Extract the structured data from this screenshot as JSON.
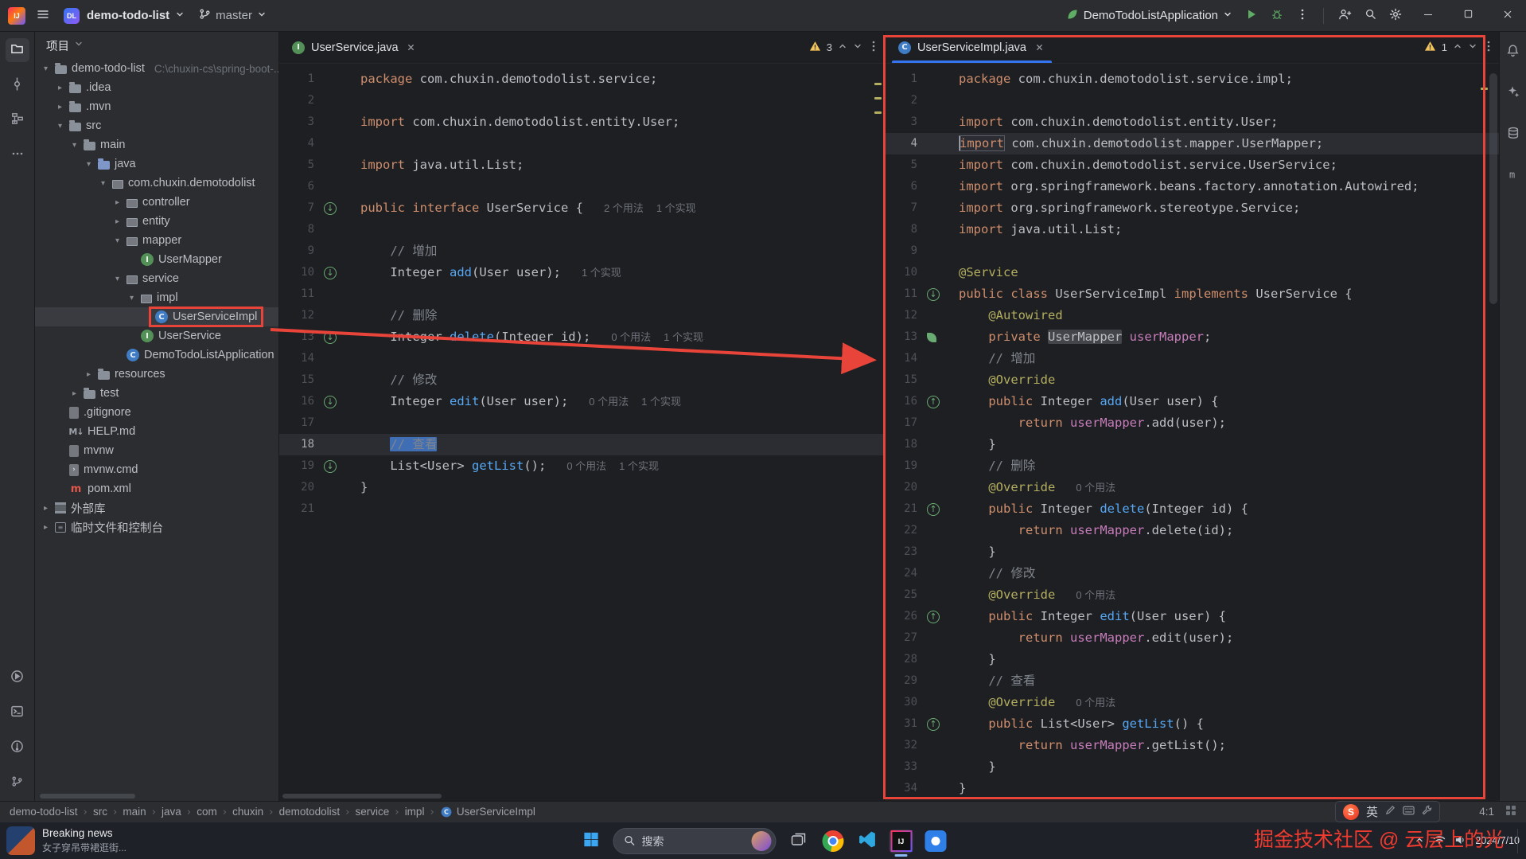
{
  "titlebar": {
    "app_logo": "IJ",
    "project_badge": "DL",
    "project_name": "demo-todo-list",
    "branch_name": "master",
    "run_config_name": "DemoTodoListApplication"
  },
  "project_panel": {
    "title": "项目",
    "tree": [
      {
        "level": 0,
        "chev": "down",
        "icon": "project",
        "label": "demo-todo-list",
        "hint": "C:\\chuxin-cs\\spring-boot-..."
      },
      {
        "level": 1,
        "chev": "right",
        "icon": "folder",
        "label": ".idea"
      },
      {
        "level": 1,
        "chev": "right",
        "icon": "folder",
        "label": ".mvn"
      },
      {
        "level": 1,
        "chev": "down",
        "icon": "folder",
        "label": "src"
      },
      {
        "level": 2,
        "chev": "down",
        "icon": "folder",
        "label": "main"
      },
      {
        "level": 3,
        "chev": "down",
        "icon": "src-folder",
        "label": "java"
      },
      {
        "level": 4,
        "chev": "down",
        "icon": "package",
        "label": "com.chuxin.demotodolist"
      },
      {
        "level": 5,
        "chev": "right",
        "icon": "package",
        "label": "controller"
      },
      {
        "level": 5,
        "chev": "right",
        "icon": "package",
        "label": "entity"
      },
      {
        "level": 5,
        "chev": "down",
        "icon": "package",
        "label": "mapper"
      },
      {
        "level": 6,
        "chev": "none",
        "icon": "interface",
        "label": "UserMapper"
      },
      {
        "level": 5,
        "chev": "down",
        "icon": "package",
        "label": "service"
      },
      {
        "level": 6,
        "chev": "down",
        "icon": "package",
        "label": "impl"
      },
      {
        "level": 7,
        "chev": "none",
        "icon": "class",
        "label": "UserServiceImpl",
        "selected": true,
        "boxed": true
      },
      {
        "level": 6,
        "chev": "none",
        "icon": "interface",
        "label": "UserService"
      },
      {
        "level": 5,
        "chev": "none",
        "icon": "class",
        "label": "DemoTodoListApplication"
      },
      {
        "level": 3,
        "chev": "right",
        "icon": "folder",
        "label": "resources"
      },
      {
        "level": 2,
        "chev": "right",
        "icon": "folder",
        "label": "test"
      },
      {
        "level": 1,
        "chev": "none",
        "icon": "git-file",
        "label": ".gitignore"
      },
      {
        "level": 1,
        "chev": "none",
        "icon": "markdown",
        "label": "HELP.md"
      },
      {
        "level": 1,
        "chev": "none",
        "icon": "file",
        "label": "mvnw"
      },
      {
        "level": 1,
        "chev": "none",
        "icon": "cmd-file",
        "label": "mvnw.cmd"
      },
      {
        "level": 1,
        "chev": "none",
        "icon": "maven",
        "label": "pom.xml"
      },
      {
        "level": 0,
        "chev": "right",
        "icon": "library",
        "label": "外部库"
      },
      {
        "level": 0,
        "chev": "right",
        "icon": "scratch",
        "label": "临时文件和控制台"
      }
    ]
  },
  "editors": {
    "left": {
      "tab_label": "UserService.java",
      "warning_count": "3",
      "lines": [
        {
          "n": "1",
          "t": [
            [
              "k",
              "package"
            ],
            [
              "d",
              " com.chuxin.demotodolist.service;"
            ]
          ]
        },
        {
          "n": "2",
          "t": []
        },
        {
          "n": "3",
          "t": [
            [
              "k",
              "import"
            ],
            [
              "d",
              " com.chuxin.demotodolist.entity.User;"
            ]
          ]
        },
        {
          "n": "4",
          "t": []
        },
        {
          "n": "5",
          "t": [
            [
              "k",
              "import"
            ],
            [
              "d",
              " java.util.List;"
            ]
          ]
        },
        {
          "n": "6",
          "t": []
        },
        {
          "n": "7",
          "g": "impl",
          "t": [
            [
              "k",
              "public"
            ],
            [
              "d",
              " "
            ],
            [
              "k",
              "interface"
            ],
            [
              "d",
              " UserService {"
            ]
          ],
          "in": [
            "2 个用法",
            "1 个实现"
          ]
        },
        {
          "n": "8",
          "t": []
        },
        {
          "n": "9",
          "t": [
            [
              "d",
              "    "
            ],
            [
              "c",
              "// 增加"
            ]
          ]
        },
        {
          "n": "10",
          "g": "impl",
          "t": [
            [
              "d",
              "    Integer "
            ],
            [
              "m",
              "add"
            ],
            [
              "d",
              "(User user);"
            ]
          ],
          "in": [
            "1 个实现"
          ]
        },
        {
          "n": "11",
          "t": []
        },
        {
          "n": "12",
          "t": [
            [
              "d",
              "    "
            ],
            [
              "c",
              "// 删除"
            ]
          ]
        },
        {
          "n": "13",
          "g": "impl",
          "t": [
            [
              "d",
              "    Integer "
            ],
            [
              "m",
              "delete"
            ],
            [
              "d",
              "(Integer id);"
            ]
          ],
          "in": [
            "0 个用法",
            "1 个实现"
          ]
        },
        {
          "n": "14",
          "t": []
        },
        {
          "n": "15",
          "t": [
            [
              "d",
              "    "
            ],
            [
              "c",
              "// 修改"
            ]
          ]
        },
        {
          "n": "16",
          "g": "impl",
          "t": [
            [
              "d",
              "    Integer "
            ],
            [
              "m",
              "edit"
            ],
            [
              "d",
              "(User user);"
            ]
          ],
          "in": [
            "0 个用法",
            "1 个实现"
          ]
        },
        {
          "n": "17",
          "t": []
        },
        {
          "n": "18",
          "hl": true,
          "t": [
            [
              "d",
              "    "
            ],
            [
              "c sel",
              "// 查看"
            ]
          ]
        },
        {
          "n": "19",
          "g": "impl",
          "t": [
            [
              "d",
              "    List<User> "
            ],
            [
              "m",
              "getList"
            ],
            [
              "d",
              "();"
            ]
          ],
          "in": [
            "0 个用法",
            "1 个实现"
          ]
        },
        {
          "n": "20",
          "t": [
            [
              "d",
              "}"
            ]
          ]
        },
        {
          "n": "21",
          "t": []
        }
      ]
    },
    "right": {
      "tab_label": "UserServiceImpl.java",
      "warning_count": "1",
      "lines": [
        {
          "n": "1",
          "t": [
            [
              "k",
              "package"
            ],
            [
              "d",
              " com.chuxin.demotodolist.service.impl;"
            ]
          ]
        },
        {
          "n": "2",
          "t": []
        },
        {
          "n": "3",
          "t": [
            [
              "k",
              "import"
            ],
            [
              "d",
              " com.chuxin.demotodolist.entity.User;"
            ]
          ]
        },
        {
          "n": "4",
          "hl": true,
          "caret": true,
          "t": [
            [
              "k wb",
              "import"
            ],
            [
              "d",
              " com.chuxin.demotodolist.mapper.UserMapper;"
            ]
          ]
        },
        {
          "n": "5",
          "t": [
            [
              "k",
              "import"
            ],
            [
              "d",
              " com.chuxin.demotodolist.service.UserService;"
            ]
          ]
        },
        {
          "n": "6",
          "t": [
            [
              "k",
              "import"
            ],
            [
              "d",
              " org.springframework.beans.factory.annotation.Autowired;"
            ]
          ]
        },
        {
          "n": "7",
          "t": [
            [
              "k",
              "import"
            ],
            [
              "d",
              " org.springframework.stereotype.Service;"
            ]
          ]
        },
        {
          "n": "8",
          "t": [
            [
              "k",
              "import"
            ],
            [
              "d",
              " java.util.List;"
            ]
          ]
        },
        {
          "n": "9",
          "t": []
        },
        {
          "n": "10",
          "t": [
            [
              "a",
              "@Service"
            ]
          ]
        },
        {
          "n": "11",
          "g": "impl",
          "t": [
            [
              "k",
              "public"
            ],
            [
              "d",
              " "
            ],
            [
              "k",
              "class"
            ],
            [
              "d",
              " UserServiceImpl "
            ],
            [
              "k",
              "implements"
            ],
            [
              "d",
              " UserService {"
            ]
          ]
        },
        {
          "n": "12",
          "t": [
            [
              "d",
              "    "
            ],
            [
              "a",
              "@Autowired"
            ]
          ]
        },
        {
          "n": "13",
          "g": "bean",
          "t": [
            [
              "d",
              "    "
            ],
            [
              "k",
              "private"
            ],
            [
              "d",
              " "
            ],
            [
              "hlid",
              "UserMapper"
            ],
            [
              "d",
              " "
            ],
            [
              "f",
              "userMapper"
            ],
            [
              "d",
              ";"
            ]
          ]
        },
        {
          "n": "14",
          "t": [
            [
              "d",
              "    "
            ],
            [
              "c",
              "// 增加"
            ]
          ]
        },
        {
          "n": "15",
          "t": [
            [
              "d",
              "    "
            ],
            [
              "a",
              "@Override"
            ]
          ]
        },
        {
          "n": "16",
          "g": "over",
          "t": [
            [
              "d",
              "    "
            ],
            [
              "k",
              "public"
            ],
            [
              "d",
              " Integer "
            ],
            [
              "m",
              "add"
            ],
            [
              "d",
              "(User user) {"
            ]
          ]
        },
        {
          "n": "17",
          "t": [
            [
              "d",
              "        "
            ],
            [
              "k",
              "return"
            ],
            [
              "d",
              " "
            ],
            [
              "f",
              "userMapper"
            ],
            [
              "d",
              ".add(user);"
            ]
          ]
        },
        {
          "n": "18",
          "t": [
            [
              "d",
              "    }"
            ]
          ]
        },
        {
          "n": "19",
          "t": [
            [
              "d",
              "    "
            ],
            [
              "c",
              "// 删除"
            ]
          ]
        },
        {
          "n": "20",
          "t": [
            [
              "d",
              "    "
            ],
            [
              "a",
              "@Override"
            ]
          ],
          "in": [
            "0 个用法"
          ]
        },
        {
          "n": "21",
          "g": "over",
          "t": [
            [
              "d",
              "    "
            ],
            [
              "k",
              "public"
            ],
            [
              "d",
              " Integer "
            ],
            [
              "m",
              "delete"
            ],
            [
              "d",
              "(Integer id) {"
            ]
          ]
        },
        {
          "n": "22",
          "t": [
            [
              "d",
              "        "
            ],
            [
              "k",
              "return"
            ],
            [
              "d",
              " "
            ],
            [
              "f",
              "userMapper"
            ],
            [
              "d",
              ".delete(id);"
            ]
          ]
        },
        {
          "n": "23",
          "t": [
            [
              "d",
              "    }"
            ]
          ]
        },
        {
          "n": "24",
          "t": [
            [
              "d",
              "    "
            ],
            [
              "c",
              "// 修改"
            ]
          ]
        },
        {
          "n": "25",
          "t": [
            [
              "d",
              "    "
            ],
            [
              "a",
              "@Override"
            ]
          ],
          "in": [
            "0 个用法"
          ]
        },
        {
          "n": "26",
          "g": "over",
          "t": [
            [
              "d",
              "    "
            ],
            [
              "k",
              "public"
            ],
            [
              "d",
              " Integer "
            ],
            [
              "m",
              "edit"
            ],
            [
              "d",
              "(User user) {"
            ]
          ]
        },
        {
          "n": "27",
          "t": [
            [
              "d",
              "        "
            ],
            [
              "k",
              "return"
            ],
            [
              "d",
              " "
            ],
            [
              "f",
              "userMapper"
            ],
            [
              "d",
              ".edit(user);"
            ]
          ]
        },
        {
          "n": "28",
          "t": [
            [
              "d",
              "    }"
            ]
          ]
        },
        {
          "n": "29",
          "t": [
            [
              "d",
              "    "
            ],
            [
              "c",
              "// 查看"
            ]
          ]
        },
        {
          "n": "30",
          "t": [
            [
              "d",
              "    "
            ],
            [
              "a",
              "@Override"
            ]
          ],
          "in": [
            "0 个用法"
          ]
        },
        {
          "n": "31",
          "g": "over",
          "t": [
            [
              "d",
              "    "
            ],
            [
              "k",
              "public"
            ],
            [
              "d",
              " List<User> "
            ],
            [
              "m",
              "getList"
            ],
            [
              "d",
              "() {"
            ]
          ]
        },
        {
          "n": "32",
          "t": [
            [
              "d",
              "        "
            ],
            [
              "k",
              "return"
            ],
            [
              "d",
              " "
            ],
            [
              "f",
              "userMapper"
            ],
            [
              "d",
              ".getList();"
            ]
          ]
        },
        {
          "n": "33",
          "t": [
            [
              "d",
              "    }"
            ]
          ]
        },
        {
          "n": "34",
          "t": [
            [
              "d",
              "}"
            ]
          ]
        }
      ]
    }
  },
  "statusbar": {
    "breadcrumbs": [
      "demo-todo-list",
      "src",
      "main",
      "java",
      "com",
      "chuxin",
      "demotodolist",
      "service",
      "impl",
      "UserServiceImpl"
    ],
    "caret_position": "4:1"
  },
  "taskbar": {
    "news_title": "Breaking news",
    "news_subtitle": "女子穿吊带裙逛街...",
    "search_placeholder": "搜索",
    "date": "2024/7/10",
    "ime_mode": "英"
  },
  "watermark": {
    "text": "掘金技术社区 @ 云层上的光"
  }
}
